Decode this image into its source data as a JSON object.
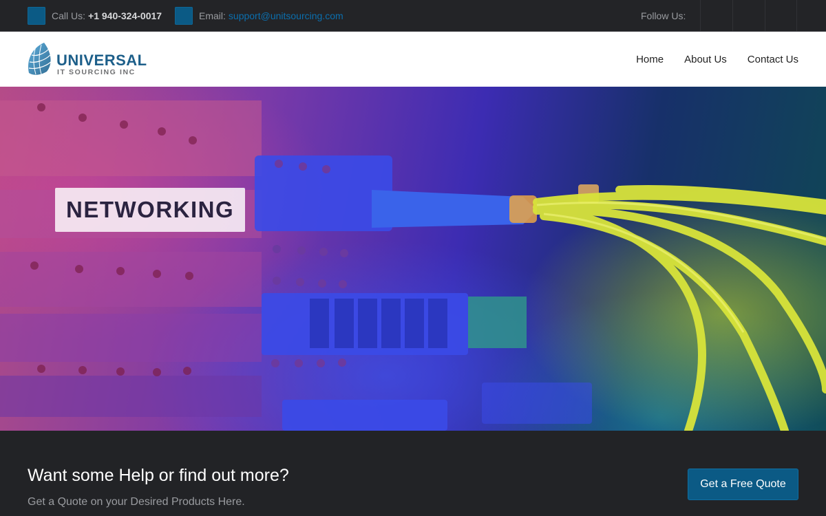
{
  "topbar": {
    "call_label": "Call Us:",
    "phone": "+1 940-324-0017",
    "email_label": "Email:",
    "email": "support@unitsourcing.com",
    "follow_label": "Follow Us:"
  },
  "header": {
    "logo_title": "UNIVERSAL",
    "logo_subtitle": "IT SOURCING INC",
    "nav": [
      {
        "label": "Home"
      },
      {
        "label": "About Us"
      },
      {
        "label": "Contact Us"
      }
    ]
  },
  "hero": {
    "title": "NETWORKING"
  },
  "cta": {
    "title": "Want some Help or find out more?",
    "subtitle": "Get a Quote on your Desired Products Here.",
    "button_label": "Get a Free Quote"
  },
  "colors": {
    "accent": "#0b5a85",
    "brand": "#1d5f8a",
    "topbar_bg": "#232427",
    "cta_bg": "#222326"
  },
  "icons": {
    "phone": "phone-icon",
    "email": "email-icon",
    "social": [
      "social-icon-1",
      "social-icon-2",
      "social-icon-3"
    ]
  }
}
